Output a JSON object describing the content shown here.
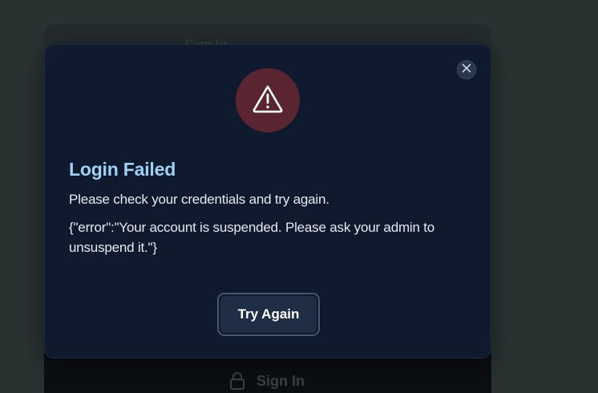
{
  "background": {
    "heading": "Sign In",
    "signin_label": "Sign In"
  },
  "modal": {
    "title": "Login Failed",
    "message": "Please check your credentials and try again.",
    "error_detail": "{\"error\":\"Your account is suspended. Please ask your admin to unsuspend it.\"}",
    "button_label": "Try Again",
    "icons": {
      "alert": "warning-triangle-icon",
      "close": "close-icon",
      "lock": "lock-icon"
    },
    "colors": {
      "title": "#9fd3f5",
      "alert_bg": "#5a2530",
      "modal_bg": "#0f1a2e"
    }
  }
}
